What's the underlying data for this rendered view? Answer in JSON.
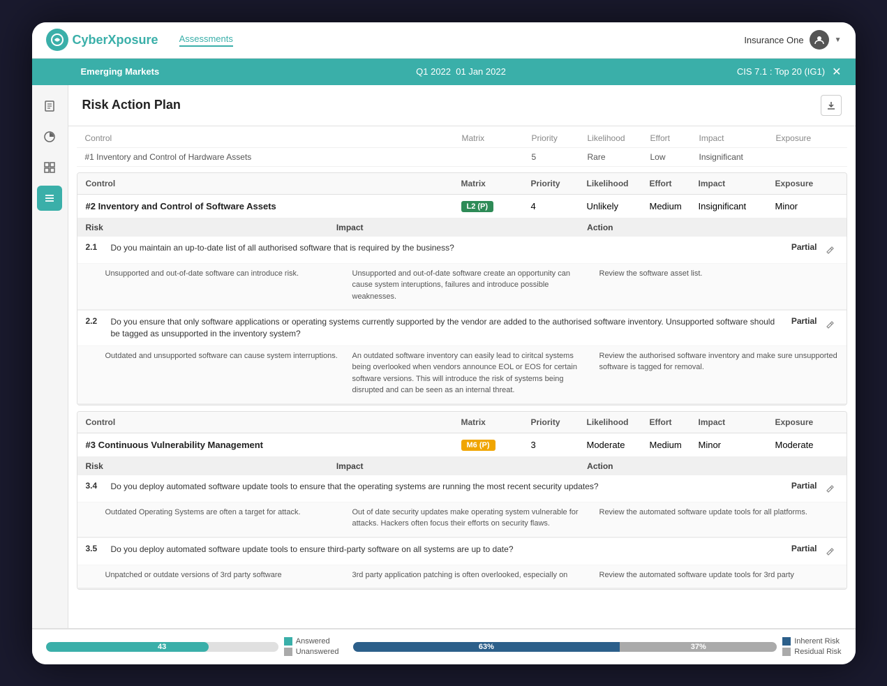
{
  "app": {
    "logo_text_black": "Cyber",
    "logo_text_teal": "Xposure",
    "nav_link": "Assessments",
    "company": "Insurance One"
  },
  "sub_header": {
    "title": "Emerging Markets",
    "period": "Q1 2022",
    "date": "01 Jan 2022",
    "framework": "CIS 7.1 : Top 20 (IG1)"
  },
  "page": {
    "title": "Risk Action Plan"
  },
  "table_columns": {
    "control": "Control",
    "matrix": "Matrix",
    "priority": "Priority",
    "likelihood": "Likelihood",
    "effort": "Effort",
    "impact": "Impact",
    "exposure": "Exposure"
  },
  "risk_columns": {
    "risk": "Risk",
    "impact": "Impact",
    "action": "Action"
  },
  "control0": {
    "name": "#1 Inventory and Control of Hardware Assets",
    "priority": "5",
    "likelihood": "Rare",
    "effort": "Low",
    "impact": "Insignificant",
    "exposure": ""
  },
  "control1": {
    "name": "#2 Inventory and Control of Software Assets",
    "matrix": "L2 (P)",
    "matrix_color": "green",
    "priority": "4",
    "likelihood": "Unlikely",
    "effort": "Medium",
    "impact": "Insignificant",
    "exposure": "Minor",
    "risks": [
      {
        "num": "2.1",
        "question": "Do you maintain an up-to-date list of all authorised software that is required by the business?",
        "status": "Partial",
        "risk": "Unsupported and out-of-date software can introduce risk.",
        "impact": "Unsupported and out-of-date software create an opportunity can cause system interuptions, failures and introduce possible weaknesses.",
        "action": "Review the software asset list."
      },
      {
        "num": "2.2",
        "question": "Do you ensure that only software applications or operating systems currently supported by the vendor are added to the authorised software inventory. Unsupported software should be tagged as unsupported in the inventory system?",
        "status": "Partial",
        "risk": "Outdated and unsupported software can cause system interruptions.",
        "impact": "An outdated software inventory can easily lead to ciritcal systems being overlooked when vendors announce EOL or EOS for certain software versions. This will introduce the risk of systems being disrupted and can be seen as an internal threat.",
        "action": "Review the authorised software inventory and make sure unsupported software is tagged for removal."
      }
    ]
  },
  "control2": {
    "name": "#3 Continuous Vulnerability Management",
    "matrix": "M6 (P)",
    "matrix_color": "yellow",
    "priority": "3",
    "likelihood": "Moderate",
    "effort": "Medium",
    "impact": "Minor",
    "exposure": "Moderate",
    "risks": [
      {
        "num": "3.4",
        "question": "Do you deploy automated software update tools to ensure that the operating systems are running the most recent security updates?",
        "status": "Partial",
        "risk": "Outdated Operating Systems are often a target for attack.",
        "impact": "Out of date security updates make operating system vulnerable for attacks. Hackers often focus their efforts on security flaws.",
        "action": "Review the automated software update tools for all platforms."
      },
      {
        "num": "3.5",
        "question": "Do you deploy automated software update tools to ensure third-party software on all systems are up to date?",
        "status": "Partial",
        "risk": "Unpatched or outdate versions of 3rd party software",
        "impact": "3rd party application patching is often overlooked, especially on",
        "action": "Review the automated software update tools for 3rd party"
      }
    ]
  },
  "bottom_bar": {
    "answered_count": "43",
    "answered_label": "Answered",
    "unanswered_label": "Unanswered",
    "progress_filled_pct": 63,
    "progress_empty_pct": 37,
    "progress_filled_label": "63%",
    "progress_empty_label": "37%",
    "inherent_risk_label": "Inherent Risk",
    "residual_risk_label": "Residual Risk",
    "inherent_color": "#2c5f8a",
    "residual_color": "#aaaaaa"
  }
}
